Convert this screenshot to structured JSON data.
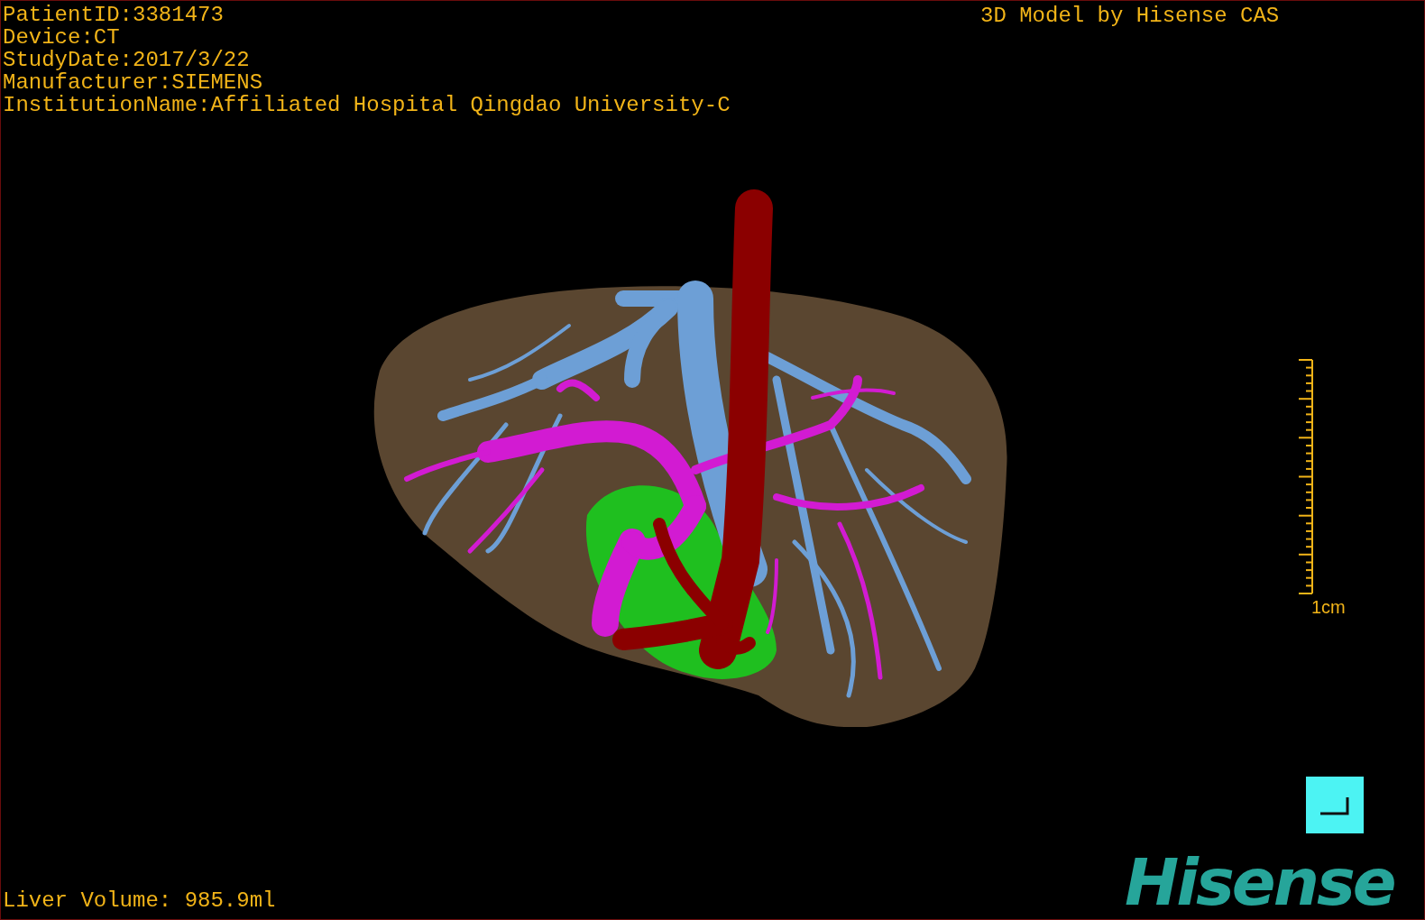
{
  "patient_info": [
    "PatientID:3381473",
    "Device:CT",
    "StudyDate:2017/3/22",
    "Manufacturer:SIEMENS",
    "InstitutionName:Affiliated Hospital Qingdao University-C"
  ],
  "model_credit": "3D Model by Hisense CAS",
  "scale_bar": {
    "label": "1cm"
  },
  "liver_volume": "Liver Volume: 985.9ml",
  "logo": "Hisense"
}
